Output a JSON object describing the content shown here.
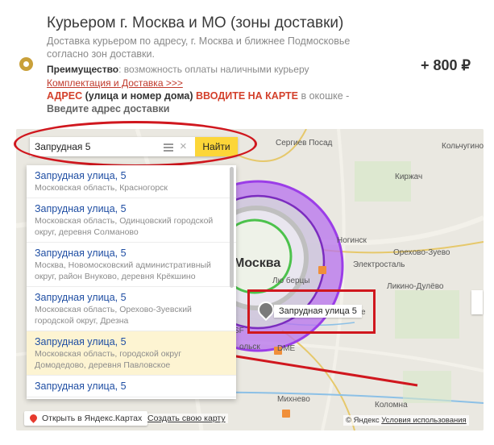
{
  "header": {
    "title": "Курьером г. Москва и МО (зоны доставки)",
    "description": "Доставка курьером по адресу, г. Москва и ближнее Подмосковье согласно зон доставки.",
    "advantage_label": "Преимущество",
    "advantage_text": ": возможность оплаты наличными курьеру",
    "link": "Комплектация и Доставка >>>",
    "address_prefix": "АДРЕС",
    "address_mid": "(улица и номер дома)",
    "address_action": "ВВОДИТЕ НА КАРТЕ",
    "address_suffix": "в окошке -",
    "enter_hint": "Введите адрес доставки",
    "price": "+ 800 ₽"
  },
  "search": {
    "value": "Запрудная 5",
    "button": "Найти"
  },
  "suggestions": [
    {
      "title": "Запрудная улица, 5",
      "sub": "Московская область, Красногорск"
    },
    {
      "title": "Запрудная улица, 5",
      "sub": "Московская область, Одинцовский городской округ, деревня Солманово"
    },
    {
      "title": "Запрудная улица, 5",
      "sub": "Москва, Новомосковский административный округ, район Внуково, деревня Крёкшино"
    },
    {
      "title": "Запрудная улица, 5",
      "sub": "Московская область, Орехово-Зуевский городской округ, Дрезна"
    },
    {
      "title": "Запрудная улица, 5",
      "sub": "Московская область, городской округ Домодедово, деревня Павловское"
    },
    {
      "title": "Запрудная улица, 5",
      "sub": ""
    }
  ],
  "map": {
    "labels": {
      "moscow": "Москва",
      "sergiev": "Сергиев Посад",
      "kolchugino": "Кольчугино",
      "kirzhach": "Киржач",
      "noginsk": "Ногинск",
      "orekhovo": "Орехово-Зуево",
      "elektrostal": "Электросталь",
      "likino": "Ликино-Дулёво",
      "lyubertsy": "Лю берцы",
      "dme": "DME",
      "kolomna": "Коломна",
      "mikhnevo": "Михнево",
      "e": "е",
      "olsk": "ольск",
      "sf": "SF"
    },
    "pin_label": "Запрудная улица 5",
    "open_button": "Открыть в Яндекс.Картах",
    "create_link": "Создать свою карту",
    "copyright": "© Яндекс",
    "terms": "Условия использования"
  },
  "colors": {
    "accent": "#d3402b",
    "zone_purple": "#a64df0",
    "button_yellow": "#fcd638"
  }
}
